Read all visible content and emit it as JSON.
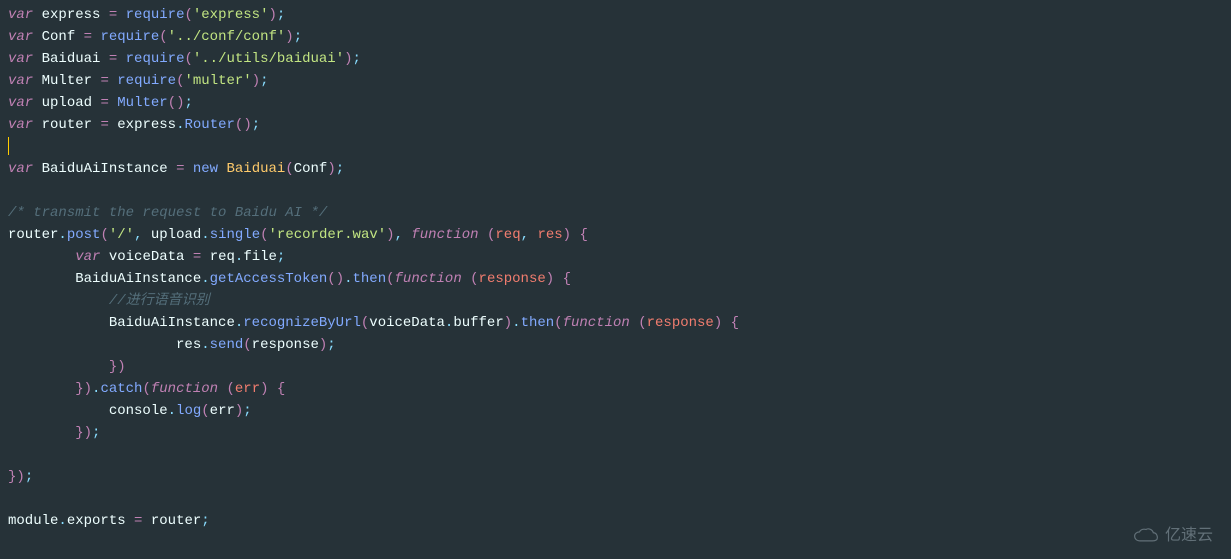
{
  "code": {
    "l1": {
      "kw": "var",
      "v": "express",
      "op": "=",
      "fn": "require",
      "paren_o": "(",
      "s": "'express'",
      "paren_c": ")",
      "semi": ";"
    },
    "l2": {
      "kw": "var",
      "v": "Conf",
      "op": "=",
      "fn": "require",
      "paren_o": "(",
      "s": "'../conf/conf'",
      "paren_c": ")",
      "semi": ";"
    },
    "l3": {
      "kw": "var",
      "v": "Baiduai",
      "op": "=",
      "fn": "require",
      "paren_o": "(",
      "s": "'../utils/baiduai'",
      "paren_c": ")",
      "semi": ";"
    },
    "l4": {
      "kw": "var",
      "v": "Multer",
      "op": "=",
      "fn": "require",
      "paren_o": "(",
      "s": "'multer'",
      "paren_c": ")",
      "semi": ";"
    },
    "l5": {
      "kw": "var",
      "v": "upload",
      "op": "=",
      "fn": "Multer",
      "paren_o": "(",
      "paren_c": ")",
      "semi": ";"
    },
    "l6": {
      "kw": "var",
      "v": "router",
      "op": "=",
      "obj": "express",
      "dot": ".",
      "m": "Router",
      "paren_o": "(",
      "paren_c": ")",
      "semi": ";"
    },
    "l7": {
      "blank": ""
    },
    "l8": {
      "kw": "var",
      "v": "BaiduAiInstance",
      "op": "=",
      "nkw": "new",
      "cls": "Baiduai",
      "paren_o": "(",
      "arg": "Conf",
      "paren_c": ")",
      "semi": ";"
    },
    "l9": {
      "blank": ""
    },
    "l10": {
      "c": "/* transmit the request to Baidu AI */"
    },
    "l11": {
      "obj": "router",
      "dot1": ".",
      "m1": "post",
      "po1": "(",
      "s1": "'/'",
      "c1": ",",
      "sp1": " ",
      "obj2": "upload",
      "dot2": ".",
      "m2": "single",
      "po2": "(",
      "s2": "'recorder.wav'",
      "pc2": ")",
      "c2": ",",
      "sp2": " ",
      "fnkw": "function",
      "sp3": " ",
      "po3": "(",
      "p1": "req",
      "c3": ",",
      "sp4": " ",
      "p2": "res",
      "pc3": ")",
      "sp5": " ",
      "brace": "{"
    },
    "l12": {
      "ind": "        ",
      "kw": "var",
      "v": "voiceData",
      "op": "=",
      "obj": "req",
      "dot": ".",
      "prop": "file",
      "semi": ";"
    },
    "l13": {
      "ind": "        ",
      "obj": "BaiduAiInstance",
      "dot1": ".",
      "m1": "getAccessToken",
      "po1": "(",
      "pc1": ")",
      "dot2": ".",
      "m2": "then",
      "po2": "(",
      "fnkw": "function",
      "sp": " ",
      "po3": "(",
      "p": "response",
      "pc3": ")",
      "sp2": " ",
      "brace": "{"
    },
    "l14": {
      "ind": "            ",
      "c": "//进行语音识别"
    },
    "l15": {
      "ind": "            ",
      "obj": "BaiduAiInstance",
      "dot1": ".",
      "m1": "recognizeByUrl",
      "po1": "(",
      "obj2": "voiceData",
      "dot2": ".",
      "prop": "buffer",
      "pc1": ")",
      "dot3": ".",
      "m2": "then",
      "po2": "(",
      "fnkw": "function",
      "sp": " ",
      "po3": "(",
      "p": "response",
      "pc3": ")",
      "sp2": " ",
      "brace": "{"
    },
    "l16": {
      "ind": "                    ",
      "obj": "res",
      "dot": ".",
      "m": "send",
      "po": "(",
      "arg": "response",
      "pc": ")",
      "semi": ";"
    },
    "l17": {
      "ind": "            ",
      "brace": "}",
      "pc": ")"
    },
    "l18": {
      "ind": "        ",
      "brace": "}",
      "pc1": ")",
      "dot": ".",
      "m": "catch",
      "po": "(",
      "fnkw": "function",
      "sp": " ",
      "po3": "(",
      "p": "err",
      "pc3": ")",
      "sp2": " ",
      "brace2": "{"
    },
    "l19": {
      "ind": "            ",
      "obj": "console",
      "dot": ".",
      "m": "log",
      "po": "(",
      "arg": "err",
      "pc": ")",
      "semi": ";"
    },
    "l20": {
      "ind": "        ",
      "brace": "}",
      "pc": ")",
      "semi": ";"
    },
    "l21": {
      "blank": ""
    },
    "l22": {
      "brace": "}",
      "pc": ")",
      "semi": ";"
    },
    "l23": {
      "blank": ""
    },
    "l24": {
      "obj": "module",
      "dot": ".",
      "prop": "exports",
      "op": "=",
      "v": "router",
      "semi": ";"
    }
  },
  "watermark": {
    "text": "亿速云"
  }
}
